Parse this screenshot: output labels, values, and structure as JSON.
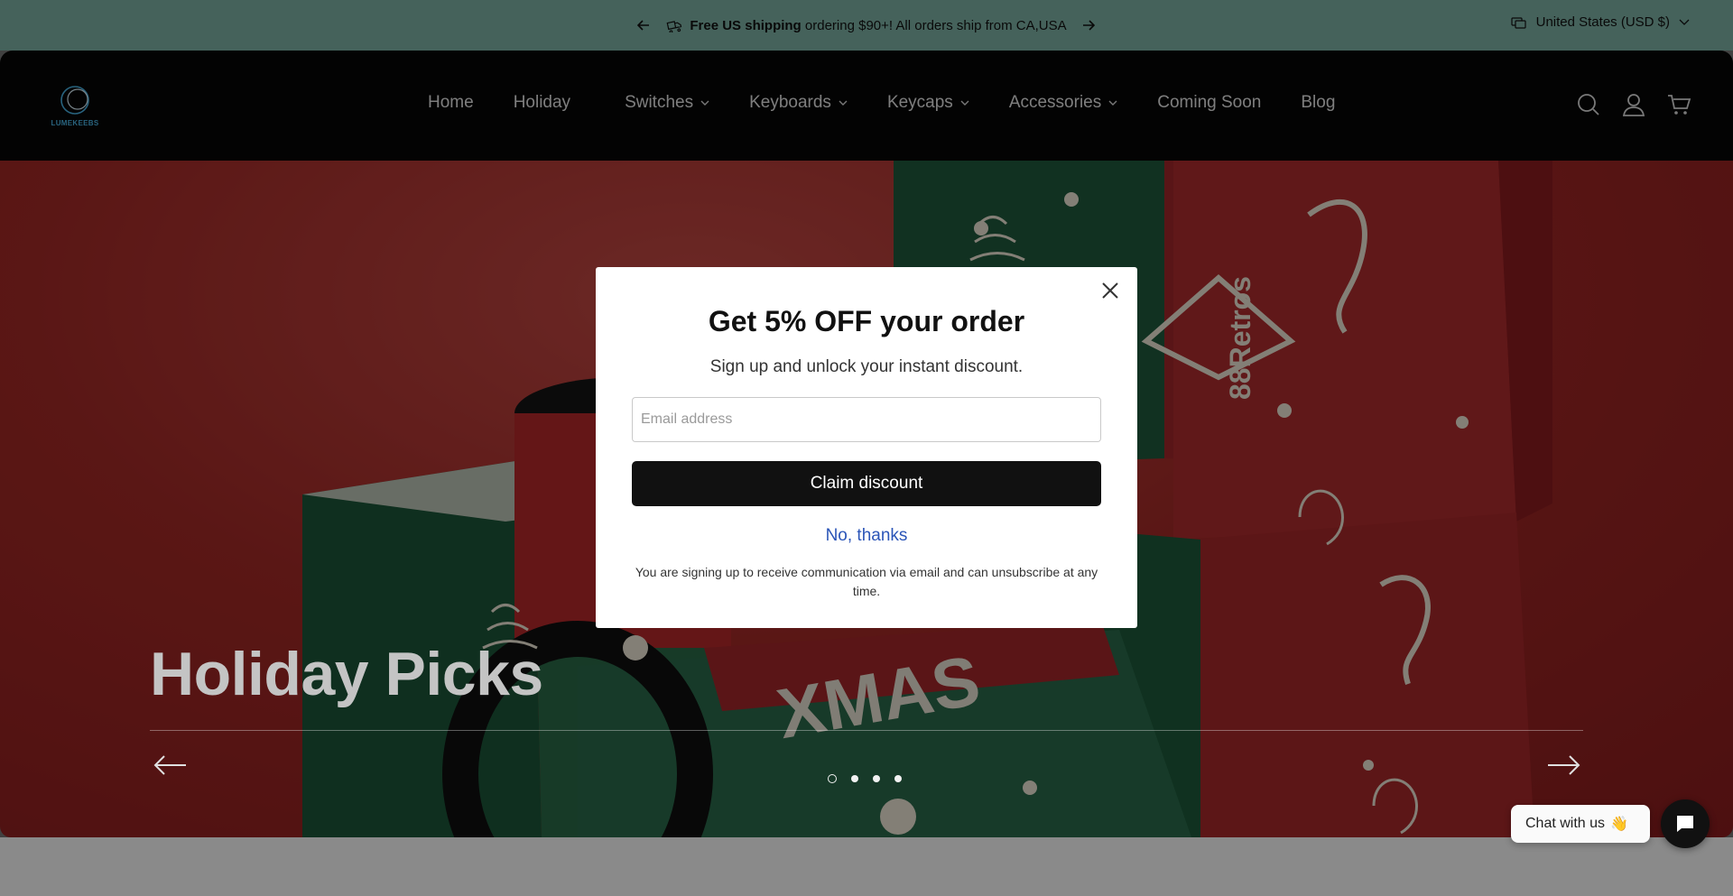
{
  "announcement": {
    "bold_text": "Free US shipping",
    "text": "ordering $90+! All orders ship from CA,USA",
    "prev_icon": "arrow-left-icon",
    "next_icon": "arrow-right-icon",
    "currency": "United States (USD $)"
  },
  "header": {
    "logo_text": "LUMEKEEBS",
    "nav": [
      {
        "label": "Home",
        "has_dropdown": false
      },
      {
        "label": "Holiday",
        "has_dropdown": false
      },
      {
        "label": "Switches",
        "has_dropdown": true
      },
      {
        "label": "Keyboards",
        "has_dropdown": true
      },
      {
        "label": "Keycaps",
        "has_dropdown": true
      },
      {
        "label": "Accessories",
        "has_dropdown": true
      },
      {
        "label": "Coming Soon",
        "has_dropdown": false
      },
      {
        "label": "Blog",
        "has_dropdown": false
      }
    ],
    "icons": [
      "search-icon",
      "account-icon",
      "cart-icon"
    ]
  },
  "hero": {
    "title": "Holiday Picks",
    "slide_count": 4,
    "active_slide": 1
  },
  "modal": {
    "title": "Get 5% OFF your order",
    "subtitle": "Sign up and unlock your instant discount.",
    "email_placeholder": "Email address",
    "claim_label": "Claim discount",
    "decline_label": "No, thanks",
    "disclaimer": "You are signing up to receive communication via email and can unsubscribe at any time."
  },
  "chat": {
    "label": "Chat with us",
    "emoji": "👋"
  },
  "colors": {
    "announcement_bg": "#7fb3a6",
    "header_bg": "#060606",
    "hero_red": "#a52a27",
    "link_blue": "#2b55b8"
  }
}
